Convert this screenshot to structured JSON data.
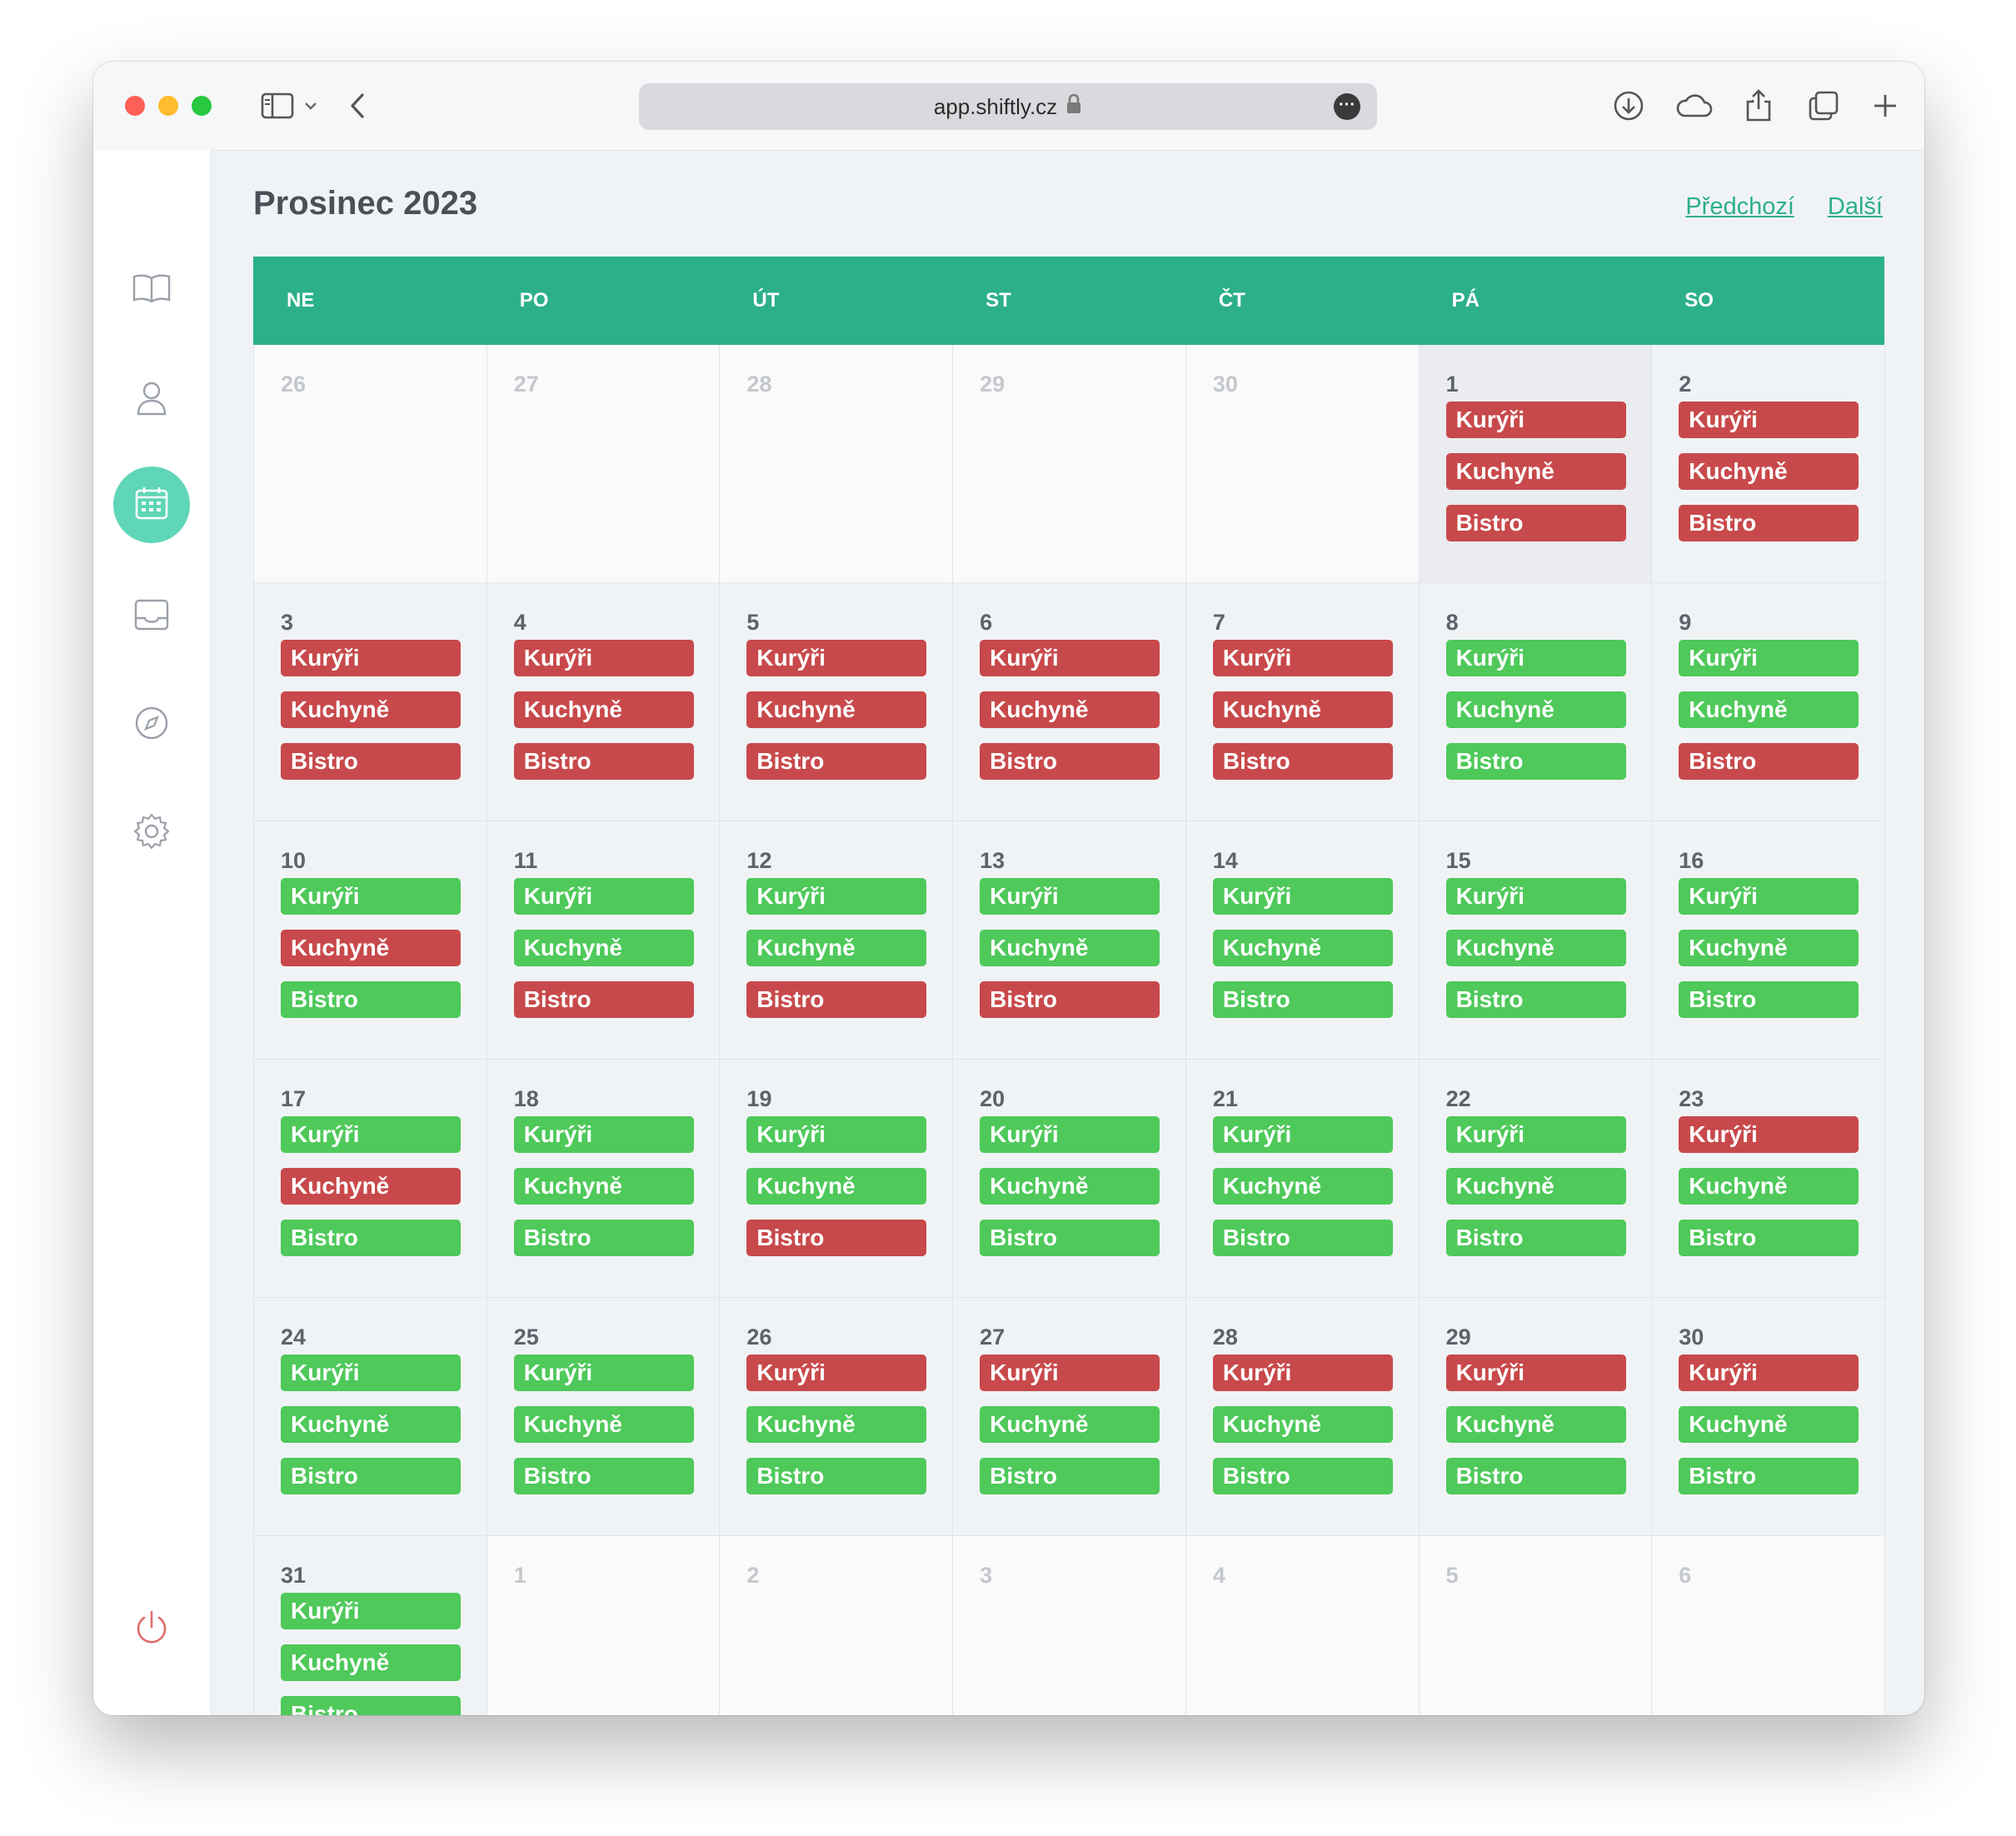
{
  "browser": {
    "url": "app.shiftly.cz"
  },
  "header": {
    "title": "Prosinec 2023",
    "prev_label": "Předchozí",
    "next_label": "Další"
  },
  "weekdays": [
    "NE",
    "PO",
    "ÚT",
    "ST",
    "ČT",
    "PÁ",
    "SO"
  ],
  "colors": {
    "ok": "#4ec95a",
    "missing": "#c8494b",
    "brand": "#2bb088"
  },
  "shift_labels": [
    "Kurýři",
    "Kuchyně",
    "Bistro"
  ],
  "weeks": [
    [
      {
        "day": "26",
        "outside": true,
        "shifts": []
      },
      {
        "day": "27",
        "outside": true,
        "shifts": []
      },
      {
        "day": "28",
        "outside": true,
        "shifts": []
      },
      {
        "day": "29",
        "outside": true,
        "shifts": []
      },
      {
        "day": "30",
        "outside": true,
        "shifts": []
      },
      {
        "day": "1",
        "today": true,
        "shifts": [
          {
            "label": "Kurýři",
            "status": "red"
          },
          {
            "label": "Kuchyně",
            "status": "red"
          },
          {
            "label": "Bistro",
            "status": "red"
          }
        ]
      },
      {
        "day": "2",
        "shifts": [
          {
            "label": "Kurýři",
            "status": "red"
          },
          {
            "label": "Kuchyně",
            "status": "red"
          },
          {
            "label": "Bistro",
            "status": "red"
          }
        ]
      }
    ],
    [
      {
        "day": "3",
        "shifts": [
          {
            "label": "Kurýři",
            "status": "red"
          },
          {
            "label": "Kuchyně",
            "status": "red"
          },
          {
            "label": "Bistro",
            "status": "red"
          }
        ]
      },
      {
        "day": "4",
        "shifts": [
          {
            "label": "Kurýři",
            "status": "red"
          },
          {
            "label": "Kuchyně",
            "status": "red"
          },
          {
            "label": "Bistro",
            "status": "red"
          }
        ]
      },
      {
        "day": "5",
        "shifts": [
          {
            "label": "Kurýři",
            "status": "red"
          },
          {
            "label": "Kuchyně",
            "status": "red"
          },
          {
            "label": "Bistro",
            "status": "red"
          }
        ]
      },
      {
        "day": "6",
        "shifts": [
          {
            "label": "Kurýři",
            "status": "red"
          },
          {
            "label": "Kuchyně",
            "status": "red"
          },
          {
            "label": "Bistro",
            "status": "red"
          }
        ]
      },
      {
        "day": "7",
        "shifts": [
          {
            "label": "Kurýři",
            "status": "red"
          },
          {
            "label": "Kuchyně",
            "status": "red"
          },
          {
            "label": "Bistro",
            "status": "red"
          }
        ]
      },
      {
        "day": "8",
        "shifts": [
          {
            "label": "Kurýři",
            "status": "green"
          },
          {
            "label": "Kuchyně",
            "status": "green"
          },
          {
            "label": "Bistro",
            "status": "green"
          }
        ]
      },
      {
        "day": "9",
        "shifts": [
          {
            "label": "Kurýři",
            "status": "green"
          },
          {
            "label": "Kuchyně",
            "status": "green"
          },
          {
            "label": "Bistro",
            "status": "red"
          }
        ]
      }
    ],
    [
      {
        "day": "10",
        "shifts": [
          {
            "label": "Kurýři",
            "status": "green"
          },
          {
            "label": "Kuchyně",
            "status": "red"
          },
          {
            "label": "Bistro",
            "status": "green"
          }
        ]
      },
      {
        "day": "11",
        "shifts": [
          {
            "label": "Kurýři",
            "status": "green"
          },
          {
            "label": "Kuchyně",
            "status": "green"
          },
          {
            "label": "Bistro",
            "status": "red"
          }
        ]
      },
      {
        "day": "12",
        "shifts": [
          {
            "label": "Kurýři",
            "status": "green"
          },
          {
            "label": "Kuchyně",
            "status": "green"
          },
          {
            "label": "Bistro",
            "status": "red"
          }
        ]
      },
      {
        "day": "13",
        "shifts": [
          {
            "label": "Kurýři",
            "status": "green"
          },
          {
            "label": "Kuchyně",
            "status": "green"
          },
          {
            "label": "Bistro",
            "status": "red"
          }
        ]
      },
      {
        "day": "14",
        "shifts": [
          {
            "label": "Kurýři",
            "status": "green"
          },
          {
            "label": "Kuchyně",
            "status": "green"
          },
          {
            "label": "Bistro",
            "status": "green"
          }
        ]
      },
      {
        "day": "15",
        "shifts": [
          {
            "label": "Kurýři",
            "status": "green"
          },
          {
            "label": "Kuchyně",
            "status": "green"
          },
          {
            "label": "Bistro",
            "status": "green"
          }
        ]
      },
      {
        "day": "16",
        "shifts": [
          {
            "label": "Kurýři",
            "status": "green"
          },
          {
            "label": "Kuchyně",
            "status": "green"
          },
          {
            "label": "Bistro",
            "status": "green"
          }
        ]
      }
    ],
    [
      {
        "day": "17",
        "shifts": [
          {
            "label": "Kurýři",
            "status": "green"
          },
          {
            "label": "Kuchyně",
            "status": "red"
          },
          {
            "label": "Bistro",
            "status": "green"
          }
        ]
      },
      {
        "day": "18",
        "shifts": [
          {
            "label": "Kurýři",
            "status": "green"
          },
          {
            "label": "Kuchyně",
            "status": "green"
          },
          {
            "label": "Bistro",
            "status": "green"
          }
        ]
      },
      {
        "day": "19",
        "shifts": [
          {
            "label": "Kurýři",
            "status": "green"
          },
          {
            "label": "Kuchyně",
            "status": "green"
          },
          {
            "label": "Bistro",
            "status": "red"
          }
        ]
      },
      {
        "day": "20",
        "shifts": [
          {
            "label": "Kurýři",
            "status": "green"
          },
          {
            "label": "Kuchyně",
            "status": "green"
          },
          {
            "label": "Bistro",
            "status": "green"
          }
        ]
      },
      {
        "day": "21",
        "shifts": [
          {
            "label": "Kurýři",
            "status": "green"
          },
          {
            "label": "Kuchyně",
            "status": "green"
          },
          {
            "label": "Bistro",
            "status": "green"
          }
        ]
      },
      {
        "day": "22",
        "shifts": [
          {
            "label": "Kurýři",
            "status": "green"
          },
          {
            "label": "Kuchyně",
            "status": "green"
          },
          {
            "label": "Bistro",
            "status": "green"
          }
        ]
      },
      {
        "day": "23",
        "shifts": [
          {
            "label": "Kurýři",
            "status": "red"
          },
          {
            "label": "Kuchyně",
            "status": "green"
          },
          {
            "label": "Bistro",
            "status": "green"
          }
        ]
      }
    ],
    [
      {
        "day": "24",
        "shifts": [
          {
            "label": "Kurýři",
            "status": "green"
          },
          {
            "label": "Kuchyně",
            "status": "green"
          },
          {
            "label": "Bistro",
            "status": "green"
          }
        ]
      },
      {
        "day": "25",
        "shifts": [
          {
            "label": "Kurýři",
            "status": "green"
          },
          {
            "label": "Kuchyně",
            "status": "green"
          },
          {
            "label": "Bistro",
            "status": "green"
          }
        ]
      },
      {
        "day": "26",
        "shifts": [
          {
            "label": "Kurýři",
            "status": "red"
          },
          {
            "label": "Kuchyně",
            "status": "green"
          },
          {
            "label": "Bistro",
            "status": "green"
          }
        ]
      },
      {
        "day": "27",
        "shifts": [
          {
            "label": "Kurýři",
            "status": "red"
          },
          {
            "label": "Kuchyně",
            "status": "green"
          },
          {
            "label": "Bistro",
            "status": "green"
          }
        ]
      },
      {
        "day": "28",
        "shifts": [
          {
            "label": "Kurýři",
            "status": "red"
          },
          {
            "label": "Kuchyně",
            "status": "green"
          },
          {
            "label": "Bistro",
            "status": "green"
          }
        ]
      },
      {
        "day": "29",
        "shifts": [
          {
            "label": "Kurýři",
            "status": "red"
          },
          {
            "label": "Kuchyně",
            "status": "green"
          },
          {
            "label": "Bistro",
            "status": "green"
          }
        ]
      },
      {
        "day": "30",
        "shifts": [
          {
            "label": "Kurýři",
            "status": "red"
          },
          {
            "label": "Kuchyně",
            "status": "green"
          },
          {
            "label": "Bistro",
            "status": "green"
          }
        ]
      }
    ],
    [
      {
        "day": "31",
        "shifts": [
          {
            "label": "Kurýři",
            "status": "green"
          },
          {
            "label": "Kuchyně",
            "status": "green"
          },
          {
            "label": "Bistro",
            "status": "green"
          }
        ]
      },
      {
        "day": "1",
        "outside": true,
        "shifts": []
      },
      {
        "day": "2",
        "outside": true,
        "shifts": []
      },
      {
        "day": "3",
        "outside": true,
        "shifts": []
      },
      {
        "day": "4",
        "outside": true,
        "shifts": []
      },
      {
        "day": "5",
        "outside": true,
        "shifts": []
      },
      {
        "day": "6",
        "outside": true,
        "shifts": []
      }
    ]
  ]
}
